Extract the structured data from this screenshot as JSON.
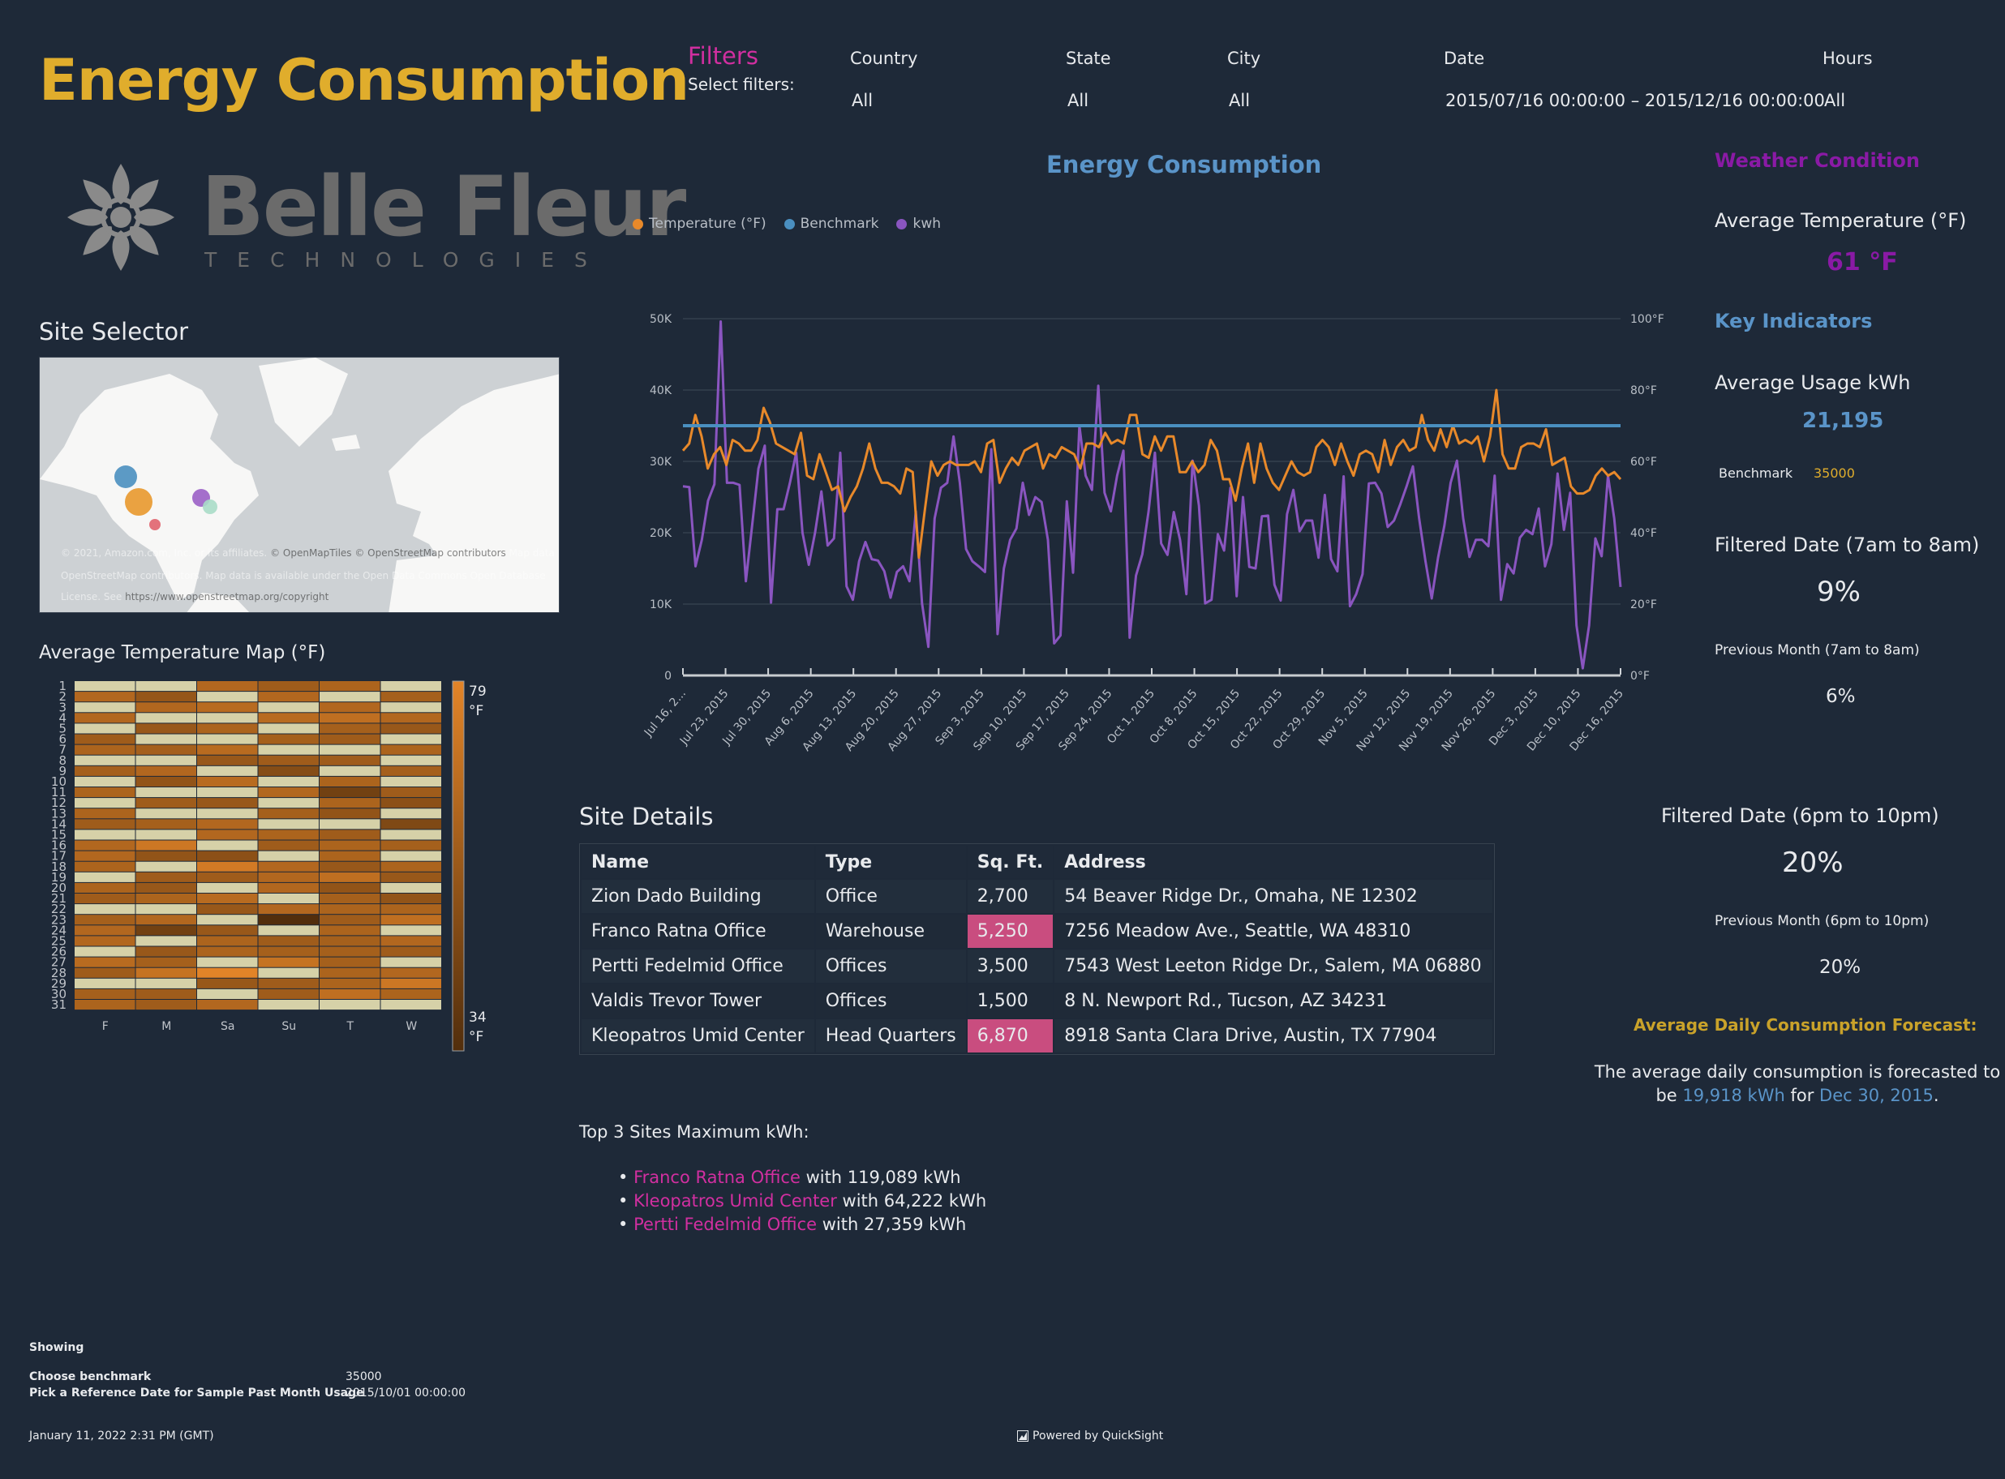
{
  "header": {
    "title": "Energy Consumption",
    "filters_label": "Filters",
    "filters_sub": "Select filters:"
  },
  "filters": [
    {
      "label": "Country",
      "value": "All"
    },
    {
      "label": "State",
      "value": "All"
    },
    {
      "label": "City",
      "value": "All"
    },
    {
      "label": "Date",
      "value": "2015/07/16 00:00:00 – 2015/12/16 00:00:00"
    },
    {
      "label": "Hours",
      "value": "All"
    }
  ],
  "logo": {
    "name": "Belle Fleur",
    "sub": "TECHNOLOGIES"
  },
  "site_selector": {
    "title": "Site Selector",
    "attribution_faded_1": "© 2021, Amazon.com, Inc. or its affiliates.",
    "attribution_strong_1": "© OpenMapTiles © OpenStreetMap contributors",
    "attribution_faded_2": "Map data ©",
    "attribution_faded_3": "OpenStreetMap contributors. Map data is available under the Open Data Commons Open Database",
    "attribution_faded_4": "License. See",
    "attribution_link": "https://www.openstreetmap.org/copyright",
    "points": [
      {
        "color": "#4a8fc0",
        "size": "medium"
      },
      {
        "color": "#e8982e",
        "size": "large"
      },
      {
        "color": "#9a5fc7",
        "size": "medium"
      },
      {
        "color": "#a8dcc8",
        "size": "small"
      },
      {
        "color": "#e0636e",
        "size": "small"
      }
    ]
  },
  "heatmap": {
    "title": "Average Temperature Map (°F)",
    "columns": [
      "F",
      "M",
      "Sa",
      "Su",
      "T",
      "W"
    ],
    "rows": [
      "1",
      "2",
      "3",
      "4",
      "5",
      "6",
      "7",
      "8",
      "9",
      "10",
      "11",
      "12",
      "13",
      "14",
      "15",
      "16",
      "17",
      "18",
      "19",
      "20",
      "21",
      "22",
      "23",
      "24",
      "25",
      "26",
      "27",
      "28",
      "29",
      "30",
      "31"
    ],
    "scale_max": "79",
    "scale_max_unit": "°F",
    "scale_min": "34",
    "scale_min_unit": "°F",
    "range": [
      34,
      79
    ],
    "values": [
      [
        null,
        null,
        64,
        58,
        62,
        null
      ],
      [
        64,
        55,
        null,
        64,
        null,
        60
      ],
      [
        null,
        64,
        66,
        null,
        64,
        null
      ],
      [
        64,
        null,
        null,
        66,
        68,
        64
      ],
      [
        null,
        56,
        62,
        null,
        60,
        56
      ],
      [
        58,
        null,
        null,
        60,
        58,
        null
      ],
      [
        62,
        60,
        66,
        null,
        null,
        62
      ],
      [
        null,
        null,
        56,
        58,
        58,
        null
      ],
      [
        60,
        64,
        null,
        50,
        null,
        60
      ],
      [
        null,
        54,
        66,
        null,
        62,
        null
      ],
      [
        62,
        null,
        null,
        64,
        44,
        58
      ],
      [
        null,
        58,
        56,
        null,
        62,
        52
      ],
      [
        62,
        null,
        null,
        60,
        54,
        null
      ],
      [
        58,
        60,
        64,
        null,
        null,
        48
      ],
      [
        null,
        null,
        64,
        62,
        58,
        null
      ],
      [
        64,
        72,
        null,
        58,
        62,
        60
      ],
      [
        64,
        54,
        52,
        null,
        62,
        null
      ],
      [
        62,
        null,
        74,
        64,
        56,
        62
      ],
      [
        null,
        58,
        58,
        64,
        68,
        56
      ],
      [
        62,
        56,
        null,
        64,
        54,
        null
      ],
      [
        58,
        62,
        66,
        null,
        60,
        54
      ],
      [
        null,
        null,
        56,
        64,
        62,
        62
      ],
      [
        60,
        64,
        null,
        34,
        58,
        68
      ],
      [
        64,
        44,
        56,
        null,
        62,
        null
      ],
      [
        64,
        null,
        62,
        58,
        60,
        64
      ],
      [
        null,
        56,
        62,
        60,
        60,
        58
      ],
      [
        66,
        60,
        null,
        70,
        60,
        null
      ],
      [
        58,
        70,
        79,
        null,
        62,
        64
      ],
      [
        null,
        null,
        56,
        58,
        62,
        72
      ],
      [
        60,
        58,
        null,
        58,
        68,
        62
      ],
      [
        62,
        58,
        64,
        null,
        null,
        null
      ]
    ]
  },
  "chart": {
    "title": "Energy Consumption",
    "legend": [
      {
        "name": "Temperature (°F)",
        "color": "#e8892a"
      },
      {
        "name": "Benchmark",
        "color": "#4a8fc0"
      },
      {
        "name": "kwh",
        "color": "#8a55c0"
      }
    ]
  },
  "chart_data": {
    "type": "line",
    "title": "Energy Consumption",
    "xlabel": "",
    "ylabel": "kwh",
    "y2label": "Temperature (°F)",
    "ylim": [
      0,
      50000
    ],
    "y2lim": [
      0,
      100
    ],
    "yticks": [
      "0",
      "10K",
      "20K",
      "30K",
      "40K",
      "50K"
    ],
    "y2ticks": [
      "0°F",
      "20°F",
      "40°F",
      "60°F",
      "80°F",
      "100°F"
    ],
    "xticks": [
      "Jul 16, 2...",
      "Jul 23, 2015",
      "Jul 30, 2015",
      "Aug 6, 2015",
      "Aug 13, 2015",
      "Aug 20, 2015",
      "Aug 27, 2015",
      "Sep 3, 2015",
      "Sep 10, 2015",
      "Sep 17, 2015",
      "Sep 24, 2015",
      "Oct 1, 2015",
      "Oct 8, 2015",
      "Oct 15, 2015",
      "Oct 22, 2015",
      "Oct 29, 2015",
      "Nov 5, 2015",
      "Nov 12, 2015",
      "Nov 19, 2015",
      "Nov 26, 2015",
      "Dec 3, 2015",
      "Dec 10, 2015",
      "Dec 16, 2015"
    ],
    "x_start": "2015-07-16",
    "x_end": "2015-12-16",
    "grid": true,
    "legend_position": "top-left",
    "series": [
      {
        "name": "kwh",
        "axis": "left",
        "values": [
          26500,
          26400,
          15300,
          19000,
          24500,
          26800,
          49600,
          27000,
          27000,
          26700,
          13200,
          21000,
          29000,
          32200,
          10200,
          23300,
          23300,
          27000,
          31200,
          20000,
          15500,
          20000,
          25800,
          18200,
          19200,
          31200,
          12500,
          10600,
          16000,
          18700,
          16300,
          16100,
          14600,
          10900,
          14500,
          15300,
          13200,
          23000,
          10100,
          4000,
          22000,
          26300,
          27000,
          33500,
          27000,
          17700,
          16000,
          15300,
          14500,
          31700,
          5800,
          15000,
          19000,
          20600,
          27000,
          22500,
          25000,
          24300,
          19000,
          4500,
          5600,
          24400,
          14400,
          35000,
          28000,
          26000,
          40600,
          25600,
          23000,
          28000,
          31500,
          5300,
          14000,
          17000,
          23000,
          31200,
          18500,
          16900,
          22900,
          19000,
          11400,
          30100,
          23800,
          10100,
          10600,
          19800,
          17500,
          26300,
          11100,
          25000,
          15200,
          15000,
          22300,
          22400,
          12700,
          10500,
          22600,
          26000,
          20200,
          21700,
          21700,
          16500,
          25300,
          16300,
          14600,
          27900,
          9700,
          11400,
          14200,
          26900,
          27000,
          25500,
          20800,
          21700,
          24000,
          26500,
          29300,
          22000,
          16000,
          10800,
          16500,
          21000,
          27000,
          30100,
          22000,
          16600,
          19000,
          19000,
          18100,
          28000,
          10600,
          15600,
          14300,
          19300,
          20400,
          19800,
          23400,
          15300,
          18400,
          28300,
          20400,
          25600,
          7000,
          1000,
          7000,
          19200,
          16700,
          28000,
          22000,
          12400
        ]
      },
      {
        "name": "Temperature (°F)",
        "axis": "right",
        "values": [
          63,
          65,
          73,
          67,
          58,
          62,
          64,
          59,
          66,
          65,
          63,
          63,
          66,
          75,
          71,
          65,
          64,
          63,
          62,
          68,
          56,
          55,
          62,
          57,
          52,
          53,
          46,
          50,
          53,
          58,
          65,
          58,
          54,
          54,
          53,
          51,
          58,
          57,
          33,
          47,
          60,
          56,
          59,
          60,
          59,
          59,
          59,
          60,
          57,
          65,
          66,
          54,
          58,
          61,
          59,
          63,
          64,
          65,
          58,
          62,
          61,
          64,
          63,
          62,
          58,
          65,
          65,
          64,
          68,
          65,
          66,
          65,
          73,
          73,
          62,
          61,
          67,
          63,
          67,
          67,
          57,
          57,
          60,
          57,
          59,
          66,
          63,
          55,
          55,
          49,
          58,
          65,
          54,
          65,
          58,
          54,
          52,
          56,
          60,
          57,
          56,
          57,
          64,
          66,
          64,
          59,
          65,
          60,
          56,
          62,
          63,
          62,
          57,
          66,
          59,
          64,
          66,
          63,
          64,
          73,
          66,
          63,
          69,
          64,
          70,
          65,
          66,
          65,
          67,
          60,
          67,
          80,
          62,
          58,
          58,
          64,
          65,
          65,
          64,
          69,
          59,
          60,
          61,
          53,
          51,
          51,
          52,
          56,
          58,
          56,
          57,
          55
        ]
      },
      {
        "name": "Benchmark",
        "axis": "left",
        "constant": 35000
      }
    ]
  },
  "weather": {
    "title": "Weather Condition",
    "avg_temp_label": "Average Temperature (°F)",
    "avg_temp_value": "61 °F"
  },
  "key_indicators": {
    "title": "Key Indicators",
    "avg_usage_label": "Average Usage kWh",
    "avg_usage_value": "21,195",
    "benchmark_label": "Benchmark",
    "benchmark_value": "35000",
    "fd_morning_label": "Filtered Date (7am to 8am)",
    "fd_morning_value": "9%",
    "pm_morning_label": "Previous Month (7am to 8am)",
    "pm_morning_value": "6%",
    "fd_evening_label": "Filtered Date (6pm to 10pm)",
    "fd_evening_value": "20%",
    "pm_evening_label": "Previous Month (6pm to 10pm)",
    "pm_evening_value": "20%"
  },
  "forecast": {
    "title": "Average Daily Consumption Forecast:",
    "text_1": "The average daily consumption is forecasted to",
    "text_2": "be",
    "value": "19,918  kWh",
    "text_3": "for",
    "date": "Dec 30, 2015",
    "text_4": "."
  },
  "site_details": {
    "title": "Site Details",
    "columns": [
      "Name",
      "Type",
      "Sq. Ft.",
      "Address"
    ],
    "rows": [
      {
        "name": "Zion Dado Building",
        "type": "Office",
        "sqft": "2,700",
        "address": "54 Beaver Ridge Dr., Omaha, NE 12302",
        "highlight": false
      },
      {
        "name": "Franco Ratna Office",
        "type": "Warehouse",
        "sqft": "5,250",
        "address": "7256 Meadow Ave., Seattle, WA 48310",
        "highlight": true
      },
      {
        "name": "Pertti Fedelmid Office",
        "type": "Offices",
        "sqft": "3,500",
        "address": "7543 West Leeton Ridge Dr., Salem, MA 06880",
        "highlight": false
      },
      {
        "name": "Valdis Trevor Tower",
        "type": "Offices",
        "sqft": "1,500",
        "address": "8 N. Newport Rd., Tucson, AZ 34231",
        "highlight": false
      },
      {
        "name": "Kleopatros Umid Center",
        "type": "Head Quarters",
        "sqft": "6,870",
        "address": "8918 Santa Clara Drive, Austin, TX 77904",
        "highlight": true
      }
    ]
  },
  "top3": {
    "title": "Top 3 Sites Maximum kWh:",
    "items": [
      {
        "site": "Franco Ratna Office",
        "rest": " with 119,089 kWh"
      },
      {
        "site": "Kleopatros Umid Center",
        "rest": " with 64,222 kWh"
      },
      {
        "site": "Pertti Fedelmid Office",
        "rest": " with 27,359 kWh"
      }
    ]
  },
  "footer": {
    "showing": "Showing",
    "params": [
      {
        "label": "Choose benchmark",
        "value": "35000"
      },
      {
        "label": "Pick a Reference Date for Sample Past Month Usage",
        "value": "2015/10/01 00:00:00"
      }
    ],
    "timestamp": "January 11, 2022 2:31 PM (GMT)",
    "powered_by": "Powered by QuickSight"
  }
}
